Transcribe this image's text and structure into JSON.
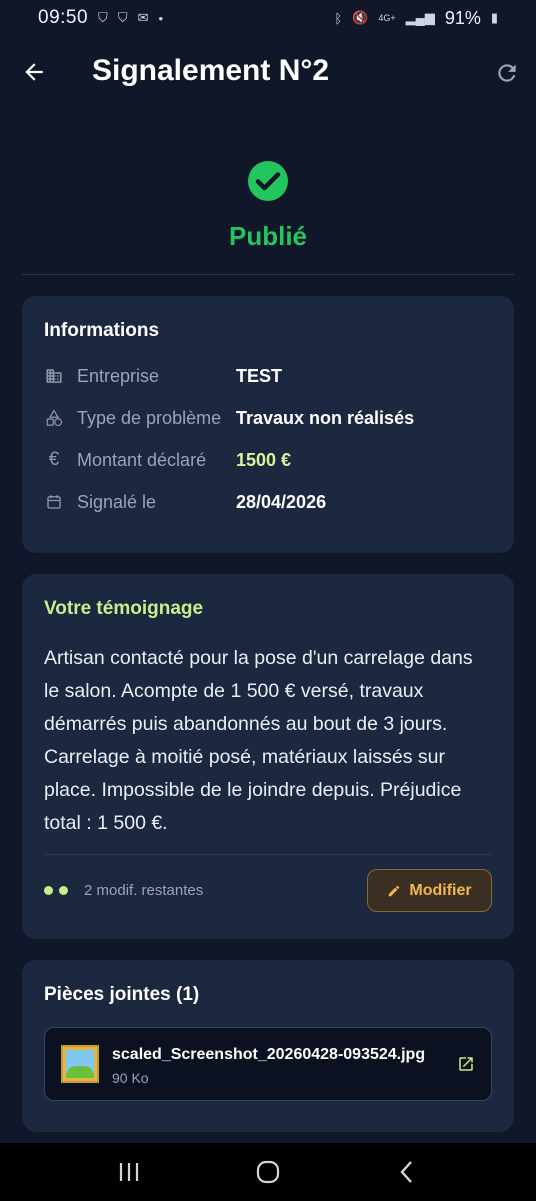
{
  "status_bar": {
    "time": "09:50",
    "battery": "91%",
    "network": "4G+"
  },
  "app_bar": {
    "title": "Signalement N°2"
  },
  "status": {
    "label": "Publié",
    "color": "#22c55e"
  },
  "info_card": {
    "title": "Informations",
    "rows": [
      {
        "icon": "building-icon",
        "label": "Entreprise",
        "value": "TEST"
      },
      {
        "icon": "category-icon",
        "label": "Type de problème",
        "value": "Travaux non réalisés"
      },
      {
        "icon": "euro-icon",
        "label": "Montant déclaré",
        "value": "1500 €"
      },
      {
        "icon": "calendar-icon",
        "label": "Signalé le",
        "value": "28/04/2026"
      }
    ]
  },
  "testimony_card": {
    "title": "Votre témoignage",
    "text": "Artisan contacté pour la pose d'un carrelage dans le salon. Acompte de 1 500 € versé, travaux démarrés puis abandonnés au bout de 3 jours. Carrelage à moitié posé, matériaux laissés sur place. Impossible de le joindre depuis. Préjudice total : 1 500 €.",
    "edits_remaining": "2 modif. restantes",
    "modify_label": "Modifier"
  },
  "attachments_card": {
    "title": "Pièces jointes (1)",
    "files": [
      {
        "name": "scaled_Screenshot_20260428-093524.jpg",
        "size": "90 Ko"
      }
    ]
  },
  "colors": {
    "background": "#0f1729",
    "card": "#1c2740",
    "accent_green": "#c6f08a",
    "amount": "#d6f59a",
    "button_orange": "#f0b74a"
  }
}
